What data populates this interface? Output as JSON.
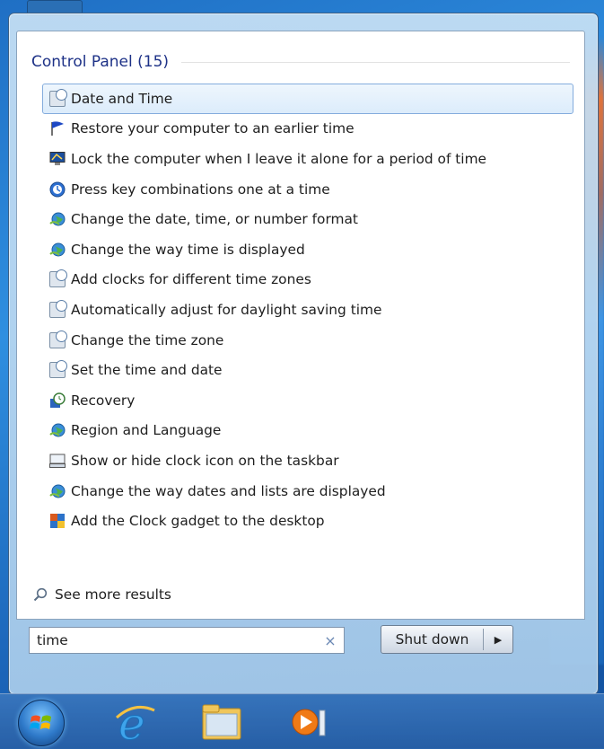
{
  "start_menu": {
    "group_title": "Control Panel (15)",
    "results": [
      {
        "label": "Date and Time",
        "icon": "date-time-icon"
      },
      {
        "label": "Restore your computer to an earlier time",
        "icon": "flag-icon"
      },
      {
        "label": "Lock the computer when I leave it alone for a period of time",
        "icon": "monitor-icon"
      },
      {
        "label": "Press key combinations one at a time",
        "icon": "ease-of-access-icon"
      },
      {
        "label": "Change the date, time, or number format",
        "icon": "globe-icon"
      },
      {
        "label": "Change the way time is displayed",
        "icon": "globe-icon"
      },
      {
        "label": "Add clocks for different time zones",
        "icon": "date-time-icon"
      },
      {
        "label": "Automatically adjust for daylight saving time",
        "icon": "date-time-icon"
      },
      {
        "label": "Change the time zone",
        "icon": "date-time-icon"
      },
      {
        "label": "Set the time and date",
        "icon": "date-time-icon"
      },
      {
        "label": "Recovery",
        "icon": "recovery-icon"
      },
      {
        "label": "Region and Language",
        "icon": "globe-icon"
      },
      {
        "label": "Show or hide clock icon on the taskbar",
        "icon": "taskbar-icon"
      },
      {
        "label": "Change the way dates and lists are displayed",
        "icon": "globe-icon"
      },
      {
        "label": "Add the Clock gadget to the desktop",
        "icon": "gadget-icon"
      }
    ],
    "selected_index": 0,
    "see_more": "See more results",
    "search": {
      "value": "time",
      "clear": "×"
    },
    "shutdown": {
      "label": "Shut down",
      "arrow": "▶"
    }
  },
  "taskbar": {
    "items": [
      "start-orb",
      "internet-explorer-icon",
      "file-explorer-icon",
      "media-player-icon"
    ]
  }
}
